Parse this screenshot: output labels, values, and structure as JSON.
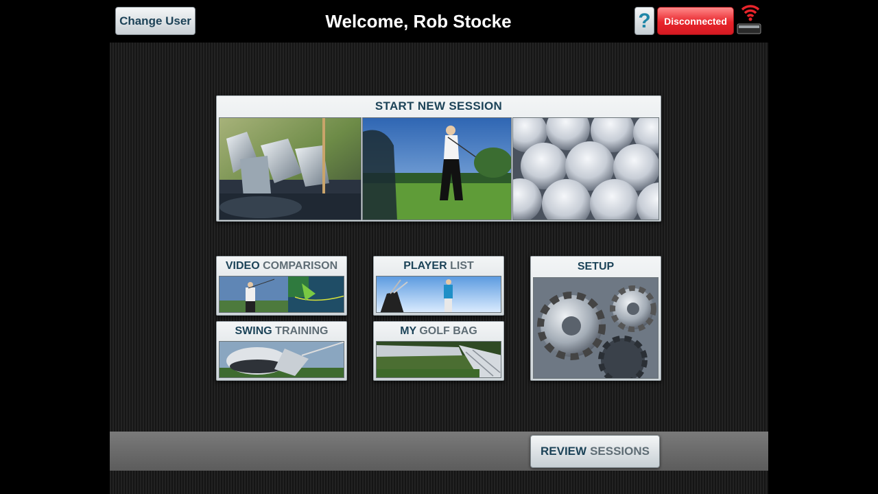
{
  "header": {
    "change_user_label": "Change User",
    "welcome_title": "Welcome,  Rob Stocke",
    "help_label": "?",
    "connection_status": "Disconnected",
    "wifi_icon": "wifi-signal-icon",
    "colors": {
      "status_red": "#e8242b",
      "help_blue": "#1f86a8",
      "title_navy": "#1c4358"
    }
  },
  "main": {
    "start_session": {
      "label": "START NEW SESSION"
    },
    "tiles": {
      "video_comparison": {
        "word1": "VIDEO",
        "word2": "COMPARISON"
      },
      "player_list": {
        "word1": "PLAYER",
        "word2": "LIST"
      },
      "setup": {
        "word1": "SETUP",
        "word2": ""
      },
      "swing_training": {
        "word1": "SWING",
        "word2": "TRAINING"
      },
      "my_golf_bag": {
        "word1": "MY",
        "word2": "GOLF BAG"
      }
    }
  },
  "footer": {
    "review_sessions": {
      "word1": "REVIEW",
      "word2": "SESSIONS"
    }
  }
}
